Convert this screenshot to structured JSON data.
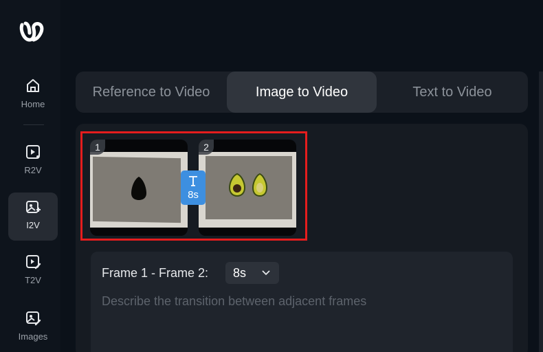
{
  "sidebar": {
    "logo_icon": "brand-logo-icon",
    "items": [
      {
        "label": "Home",
        "icon": "home-icon"
      },
      {
        "label": "R2V",
        "icon": "play-square-icon"
      },
      {
        "label": "I2V",
        "icon": "image-add-icon",
        "active": true
      },
      {
        "label": "T2V",
        "icon": "play-edit-icon"
      },
      {
        "label": "Images",
        "icon": "image-edit-icon"
      }
    ]
  },
  "tabs": [
    {
      "label": "Reference to Video"
    },
    {
      "label": "Image to Video",
      "active": true
    },
    {
      "label": "Text to Video"
    }
  ],
  "frames": [
    {
      "index": "1",
      "content": "dark object on gray tray"
    },
    {
      "index": "2",
      "content": "two avocado halves on gray tray"
    }
  ],
  "transition": {
    "icon": "text-t-icon",
    "duration": "8s"
  },
  "prompt": {
    "label": "Frame 1 - Frame 2:",
    "duration_value": "8s",
    "placeholder": "Describe the transition between adjacent frames"
  },
  "colors": {
    "background": "#0b1119",
    "accent": "#3d8fe0",
    "highlight": "#e51d1d"
  }
}
